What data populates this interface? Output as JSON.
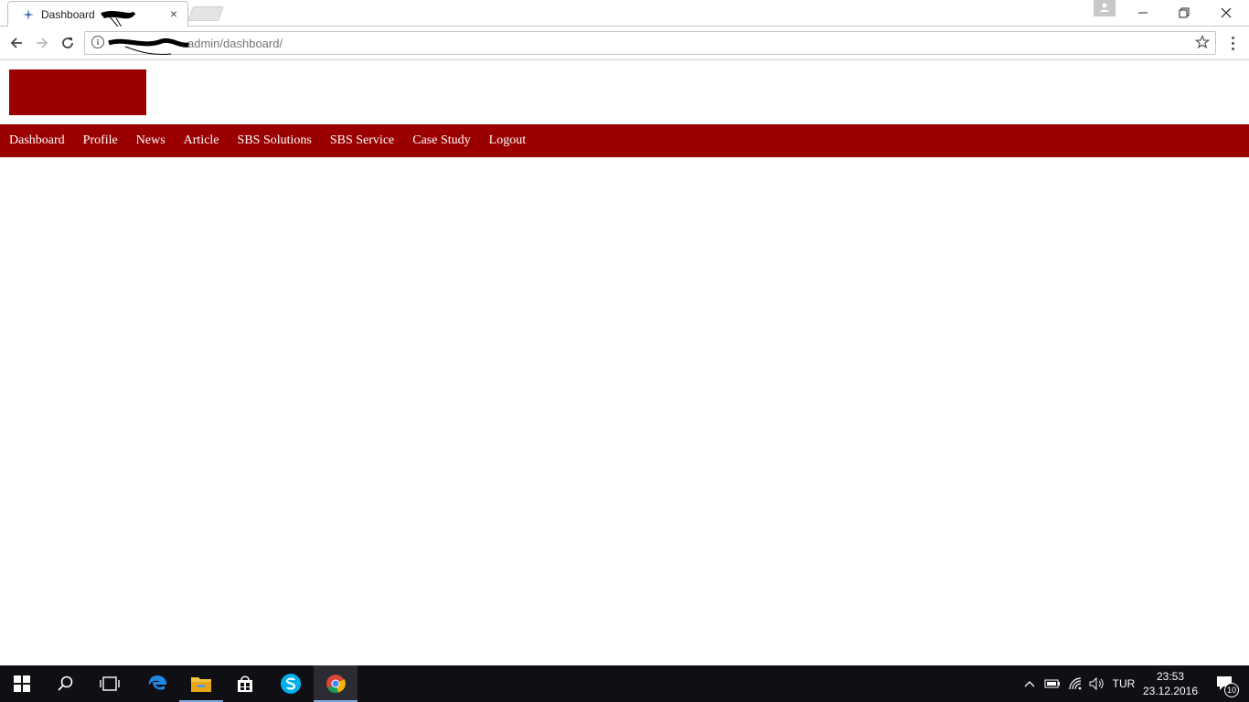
{
  "browser": {
    "tab_title": "Dashboard",
    "tab_close": "×",
    "url": "admin/dashboard/",
    "window_controls": {
      "minimize": "—",
      "restore": "❐",
      "close": "✕"
    }
  },
  "page": {
    "nav": [
      {
        "label": "Dashboard"
      },
      {
        "label": "Profile"
      },
      {
        "label": "News"
      },
      {
        "label": "Article"
      },
      {
        "label": "SBS Solutions"
      },
      {
        "label": "SBS Service"
      },
      {
        "label": "Case Study"
      },
      {
        "label": "Logout"
      }
    ],
    "accent_color": "#9b0000"
  },
  "taskbar": {
    "language": "TUR",
    "time": "23:53",
    "date": "23.12.2016",
    "notification_count": "10",
    "apps": [
      "start-icon",
      "search-icon",
      "task-view-icon",
      "edge-icon",
      "file-explorer-icon",
      "store-icon",
      "skype-icon",
      "chrome-icon"
    ]
  }
}
